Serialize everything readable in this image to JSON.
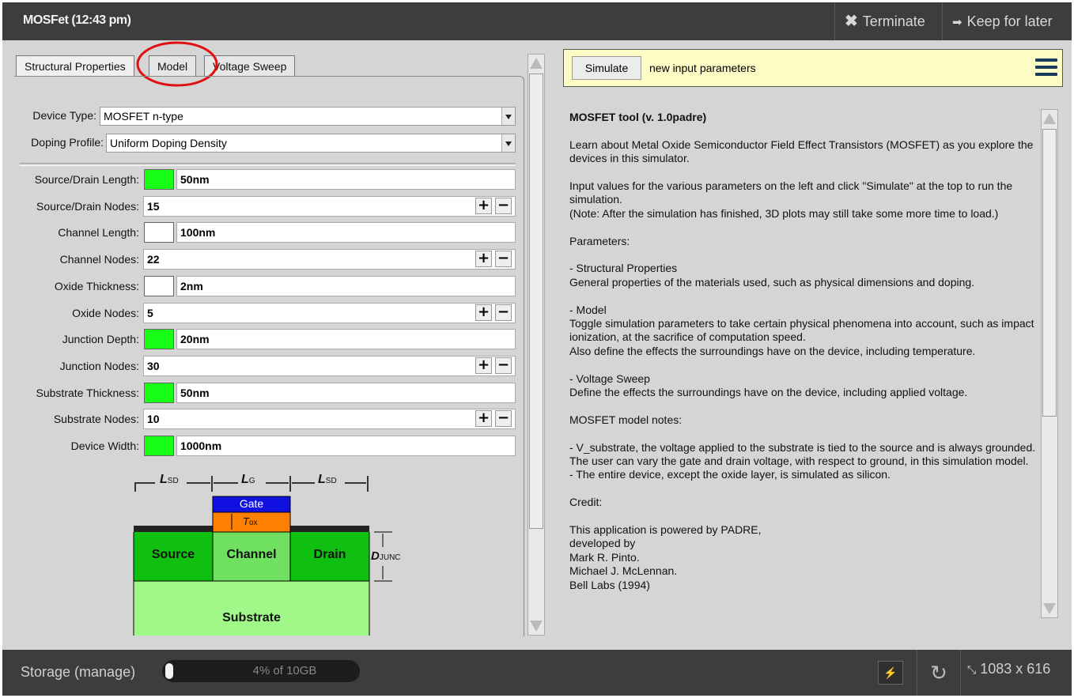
{
  "window": {
    "title": "MOSFet (12:43 pm)",
    "terminate_label": "Terminate",
    "keep_label": "Keep for later"
  },
  "tabs": [
    {
      "label": "Structural Properties"
    },
    {
      "label": "Model"
    },
    {
      "label": "Voltage Sweep"
    }
  ],
  "form": {
    "device_type_label": "Device Type:",
    "device_type_value": "MOSFET n-type",
    "doping_label": "Doping Profile:",
    "doping_value": "Uniform Doping Density",
    "rows": [
      {
        "label": "Source/Drain Length:",
        "value": "50nm",
        "kind": "length",
        "swatch": "green"
      },
      {
        "label": "Source/Drain Nodes:",
        "value": "15",
        "kind": "nodes"
      },
      {
        "label": "Channel Length:",
        "value": "100nm",
        "kind": "length",
        "swatch": "white"
      },
      {
        "label": "Channel Nodes:",
        "value": "22",
        "kind": "nodes"
      },
      {
        "label": "Oxide Thickness:",
        "value": "2nm",
        "kind": "length",
        "swatch": "white"
      },
      {
        "label": "Oxide Nodes:",
        "value": "5",
        "kind": "nodes"
      },
      {
        "label": "Junction Depth:",
        "value": "20nm",
        "kind": "length",
        "swatch": "green"
      },
      {
        "label": "Junction Nodes:",
        "value": "30",
        "kind": "nodes"
      },
      {
        "label": "Substrate Thickness:",
        "value": "50nm",
        "kind": "length",
        "swatch": "green"
      },
      {
        "label": "Substrate Nodes:",
        "value": "10",
        "kind": "nodes"
      },
      {
        "label": "Device Width:",
        "value": "1000nm",
        "kind": "length",
        "swatch": "green"
      }
    ],
    "plus": "+",
    "minus": "−"
  },
  "diagram": {
    "lsd": "L",
    "lsd_sub": "SD",
    "lg": "L",
    "lg_sub": "G",
    "gate": "Gate",
    "tox": "T",
    "tox_sub": "ox",
    "source": "Source",
    "channel": "Channel",
    "drain": "Drain",
    "djunc": "D",
    "djunc_sub": "JUNC",
    "substrate": "Substrate",
    "colors": {
      "gate": "#1010e0",
      "oxide": "#ff8000",
      "doped": "#10c010",
      "substrate": "#a0f888"
    }
  },
  "simulate": {
    "button_label": "Simulate",
    "message": "new input parameters"
  },
  "help": {
    "title": "MOSFET tool (v. 1.0padre)",
    "paragraphs": [
      "Learn about Metal Oxide Semiconductor Field Effect Transistors (MOSFET) as you explore the devices in this simulator.",
      "Input values for the various parameters on the left and click \"Simulate\" at the top to run the simulation.\n(Note: After the simulation has finished, 3D plots may still take some more time to load.)",
      "Parameters:",
      "- Structural Properties\nGeneral properties of the materials used, such as physical dimensions and doping.",
      "- Model\nToggle simulation parameters to take certain physical phenomena into account, such as impact ionization, at the sacrifice of computation speed.\nAlso define the effects the surroundings have on the device, including temperature.",
      "- Voltage Sweep\nDefine the effects the surroundings have on the device, including applied voltage.",
      "MOSFET model notes:",
      "- V_substrate, the voltage applied to the substrate is tied to the source and is always grounded.  The user can vary the gate and drain voltage, with respect to ground, in this simulation model.\n- The entire device, except the oxide layer, is simulated as silicon.",
      "Credit:",
      "This application is powered by PADRE,\ndeveloped by\nMark R. Pinto.\nMichael J. McLennan.\nBell Labs (1994)"
    ]
  },
  "footer": {
    "storage_label": "Storage (manage)",
    "storage_text": "4% of 10GB",
    "storage_percent": 4,
    "dimensions": "1083 x 616"
  }
}
